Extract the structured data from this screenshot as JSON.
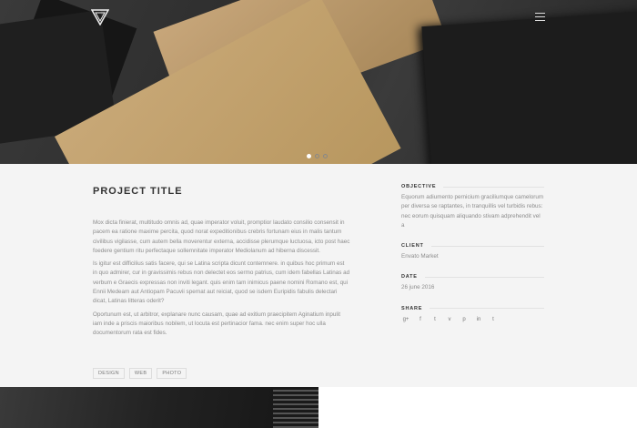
{
  "hero": {
    "slides": 3,
    "active_slide": 1
  },
  "project": {
    "title": "PROJECT TITLE",
    "paragraphs": [
      "Mox dicta finierat, multitudo omnis ad, quae imperator voluit, promptior laudato consilio consensit in pacem ea ratione maxime percita, quod norat expeditionibus crebris fortunam eius in malis tantum civilibus vigilasse, cum autem bella moverentur externa, accidisse plerumque luctuosa, icto post haec foedere gentium ritu perfectaque sollemnitate imperator Mediolanum ad hiberna discessit.",
      "Is igitur est difficilius satis facere, qui se Latina scripta dicunt contemnere. in quibus hoc primum est in quo admirer, cur in gravissimis rebus non delectet eos sermo patrius, cum idem fabellas Latinas ad verbum e Graecis expressas non inviti legant. quis enim tam inimicus paene nomini Romano est, qui Ennii Medeam aut Antiopam Pacuvii spernat aut reiciat, quod se isdem Euripidis fabulis delectari dicat, Latinas litteras oderit?",
      "Oportunum est, ut arbitror, explanare nunc causam, quae ad exitium praecipitem Aginatium inpulit iam inde a priscis maioribus nobilem, ut locuta est pertinacior fama. nec enim super hoc ulla documentorum rata est fides."
    ],
    "tags": [
      "DESIGN",
      "WEB",
      "PHOTO"
    ]
  },
  "sidebar": {
    "objective_label": "OBJECTIVE",
    "objective": "Equorum adiumento pernicium graciliumque camelorum per diversa se raptantes, in tranquillis vel turbidis rebus: nec eorum quisquam aliquando stivam adprehendit vel a",
    "client_label": "CLIENT",
    "client": "Envato Market",
    "date_label": "DATE",
    "date": "26 june 2016",
    "share_label": "SHARE",
    "share": [
      {
        "icon": "google-plus",
        "glyph": "g+"
      },
      {
        "icon": "facebook",
        "glyph": "f"
      },
      {
        "icon": "twitter",
        "glyph": "t"
      },
      {
        "icon": "vimeo",
        "glyph": "v"
      },
      {
        "icon": "pinterest",
        "glyph": "p"
      },
      {
        "icon": "linkedin",
        "glyph": "in"
      },
      {
        "icon": "tumblr",
        "glyph": "t"
      }
    ]
  }
}
